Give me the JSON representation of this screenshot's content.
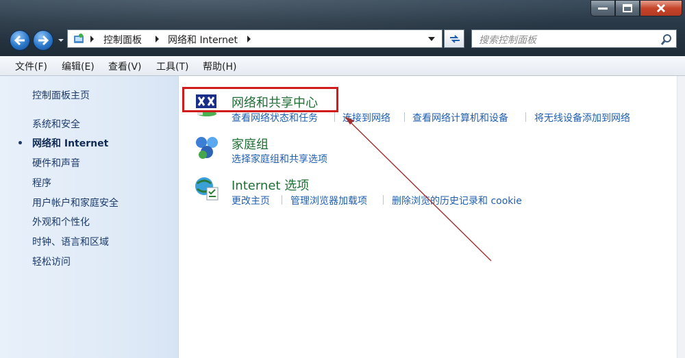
{
  "window": {
    "controls": [
      "minimize-icon",
      "maximize-icon",
      "close-icon"
    ]
  },
  "address_bar": {
    "breadcrumbs": [
      "控制面板",
      "网络和 Internet"
    ]
  },
  "search": {
    "placeholder": "搜索控制面板"
  },
  "menu": {
    "items": [
      "文件(F)",
      "编辑(E)",
      "查看(V)",
      "工具(T)",
      "帮助(H)"
    ]
  },
  "sidebar": {
    "home": "控制面板主页",
    "items": [
      {
        "label": "系统和安全"
      },
      {
        "label": "网络和 Internet",
        "active": true
      },
      {
        "label": "硬件和声音"
      },
      {
        "label": "程序"
      },
      {
        "label": "用户帐户和家庭安全"
      },
      {
        "label": "外观和个性化"
      },
      {
        "label": "时钟、语言和区域"
      },
      {
        "label": "轻松访问"
      }
    ]
  },
  "categories": [
    {
      "title": "网络和共享中心",
      "icon": "network-sharing-icon",
      "links": [
        "查看网络状态和任务",
        "连接到网络",
        "查看网络计算机和设备",
        "将无线设备添加到网络"
      ],
      "highlighted": true
    },
    {
      "title": "家庭组",
      "icon": "homegroup-icon",
      "links": [
        "选择家庭组和共享选项"
      ]
    },
    {
      "title": "Internet 选项",
      "icon": "internet-options-icon",
      "links": [
        "更改主页",
        "管理浏览器加载项",
        "删除浏览的历史记录和 cookie"
      ]
    }
  ],
  "annotation": {
    "highlight_color": "#d11c1c",
    "arrow_color": "#a03030"
  }
}
